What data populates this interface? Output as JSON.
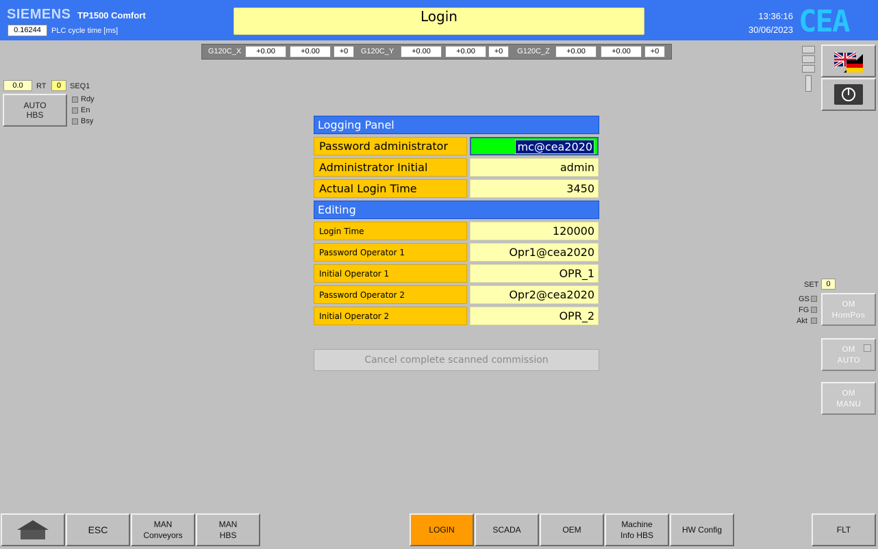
{
  "header": {
    "brand": "SIEMENS",
    "model": "TP1500 Comfort",
    "plc_cycle_value": "0.16244",
    "plc_cycle_label": "PLC cycle time [ms]",
    "title": "Login",
    "time": "13:36:16",
    "date": "30/06/2023",
    "logo": "CEA",
    "colors": {
      "header_bg": "#3875f0",
      "title_bg": "#ffff9c",
      "logo": "#27c4ff"
    }
  },
  "axes": [
    {
      "name": "G120C_X",
      "pos": "+0.00",
      "speed": "+0.00",
      "status": "+0"
    },
    {
      "name": "G120C_Y",
      "pos": "+0.00",
      "speed": "+0.00",
      "status": "+0"
    },
    {
      "name": "G120C_Z",
      "pos": "+0.00",
      "speed": "+0.00",
      "status": "+0"
    }
  ],
  "left_block": {
    "value": "0.0",
    "rt_label": "RT",
    "seq_value": "0",
    "seq_label": "SEQ1",
    "auto_button": [
      "AUTO",
      "HBS"
    ],
    "leds": [
      "Rdy",
      "En",
      "Bsy"
    ]
  },
  "panel": {
    "logging_header": "Logging Panel",
    "logging_rows": [
      {
        "label": "Password administrator",
        "value": "mc@cea2020"
      },
      {
        "label": "Administrator Initial",
        "value": "admin"
      },
      {
        "label": "Actual Login Time",
        "value": "3450"
      }
    ],
    "editing_header": "Editing",
    "editing_rows": [
      {
        "label": "Login Time",
        "value": "120000"
      },
      {
        "label": "Password Operator 1",
        "value": "Opr1@cea2020"
      },
      {
        "label": "Initial Operator 1",
        "value": "OPR_1"
      },
      {
        "label": "Password Operator 2",
        "value": "Opr2@cea2020"
      },
      {
        "label": "Initial Operator 2",
        "value": "OPR_2"
      }
    ],
    "cancel_button": "Cancel complete scanned commission",
    "colors": {
      "section_header": "#3875f0",
      "label_bg": "#ffc800",
      "value_bg": "#ffffb0",
      "active_value_bg": "#00ff00"
    }
  },
  "right_block": {
    "set_label": "SET",
    "set_value": "0",
    "leds": [
      "GS",
      "FG",
      "Akt"
    ],
    "om_buttons": [
      [
        "OM",
        "HomPos"
      ],
      [
        "OM",
        "AUTO"
      ],
      [
        "OM",
        "MANU"
      ]
    ]
  },
  "nav": {
    "home_icon": "home-icon",
    "esc": "ESC",
    "man_conveyors": [
      "MAN",
      "Conveyors"
    ],
    "man_hbs": [
      "MAN",
      "HBS"
    ],
    "login": "LOGIN",
    "scada": "SCADA",
    "oem": "OEM",
    "machine_info": [
      "Machine",
      "Info HBS"
    ],
    "hw_config": "HW Config",
    "flt": "FLT",
    "active_color": "#ff9a00"
  }
}
